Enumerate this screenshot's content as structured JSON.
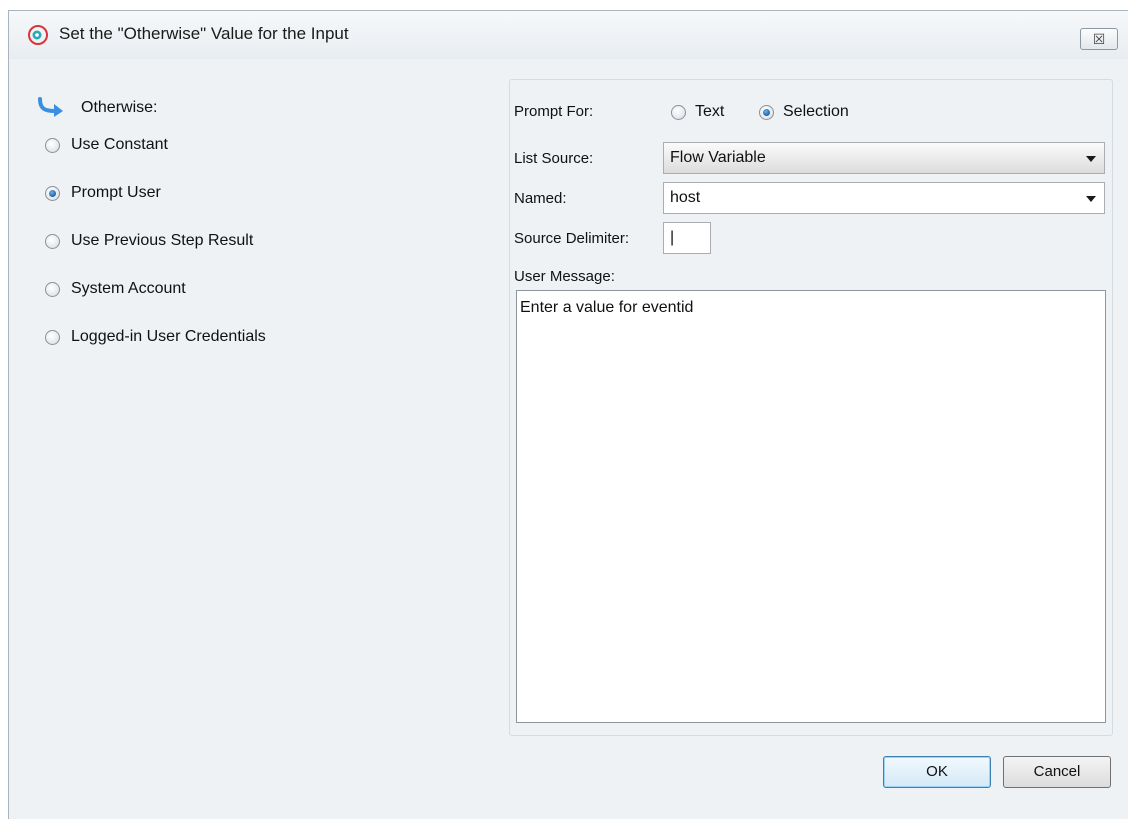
{
  "window": {
    "title": "Set the \"Otherwise\" Value for the Input",
    "close_glyph": "☒",
    "icon": "app-logo-icon"
  },
  "left": {
    "heading": "Otherwise:",
    "options": [
      {
        "label": "Use Constant",
        "checked": false
      },
      {
        "label": "Prompt User",
        "checked": true
      },
      {
        "label": "Use Previous Step Result",
        "checked": false
      },
      {
        "label": "System Account",
        "checked": false
      },
      {
        "label": "Logged-in User Credentials",
        "checked": false
      }
    ]
  },
  "form": {
    "prompt_for_label": "Prompt For:",
    "prompt_options": [
      {
        "label": "Text",
        "checked": false
      },
      {
        "label": "Selection",
        "checked": true
      }
    ],
    "list_source_label": "List Source:",
    "list_source_value": "Flow Variable",
    "named_label": "Named:",
    "named_value": "host",
    "delimiter_label": "Source Delimiter:",
    "delimiter_value": "|",
    "user_message_label": "User Message:",
    "user_message_value": "Enter a value for eventid"
  },
  "buttons": {
    "ok": "OK",
    "cancel": "Cancel"
  },
  "colors": {
    "accent": "#1e5fa8",
    "window_bg": "#eef2f5",
    "logo_red": "#d9343b",
    "arrow_blue": "#3a8fe0"
  }
}
